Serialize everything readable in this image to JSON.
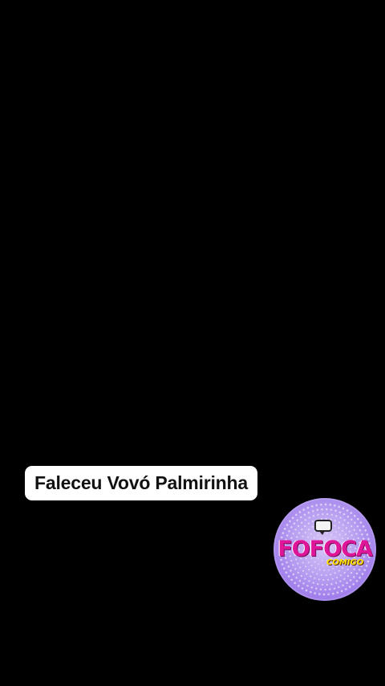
{
  "caption": {
    "text": "Faleceu Vovó Palmirinha"
  },
  "logo": {
    "title": "FOFOCA",
    "subtitle": "COMIGO",
    "icon": "speech-bubble-icon",
    "colors": {
      "background": "#a986ee",
      "title": "#e0169a",
      "subtitle": "#ffe500"
    }
  },
  "colors": {
    "background": "#000000",
    "caption_bg": "#ffffff",
    "caption_text": "#111111"
  }
}
